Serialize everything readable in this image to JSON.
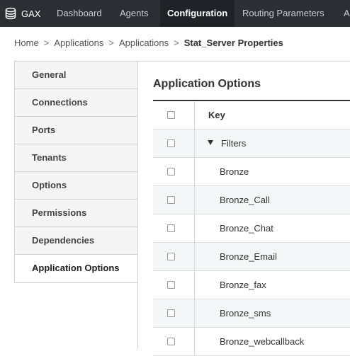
{
  "topbar": {
    "logo_text": "GAX",
    "nav": [
      "Dashboard",
      "Agents",
      "Configuration",
      "Routing Parameters",
      "A"
    ],
    "active": "Configuration"
  },
  "breadcrumb": {
    "items": [
      "Home",
      "Applications",
      "Applications"
    ],
    "current": "Stat_Server Properties",
    "separator": ">"
  },
  "sidebar": {
    "items": [
      "General",
      "Connections",
      "Ports",
      "Tenants",
      "Options",
      "Permissions",
      "Dependencies",
      "Application Options"
    ],
    "active": "Application Options"
  },
  "main": {
    "title": "Application Options",
    "table": {
      "key_header": "Key",
      "group": "Filters",
      "rows": [
        "Bronze",
        "Bronze_Call",
        "Bronze_Chat",
        "Bronze_Email",
        "Bronze_fax",
        "Bronze_sms",
        "Bronze_webcallback"
      ]
    }
  },
  "colors": {
    "topbar_bg": "#2b2f33",
    "active_nav_bg": "#1f2327",
    "sidebar_bg": "#f5f5f5",
    "row_alt_bg": "#f5f6f8"
  },
  "icons": [
    "database-stack-icon",
    "checkbox-icon",
    "caret-down-icon"
  ]
}
